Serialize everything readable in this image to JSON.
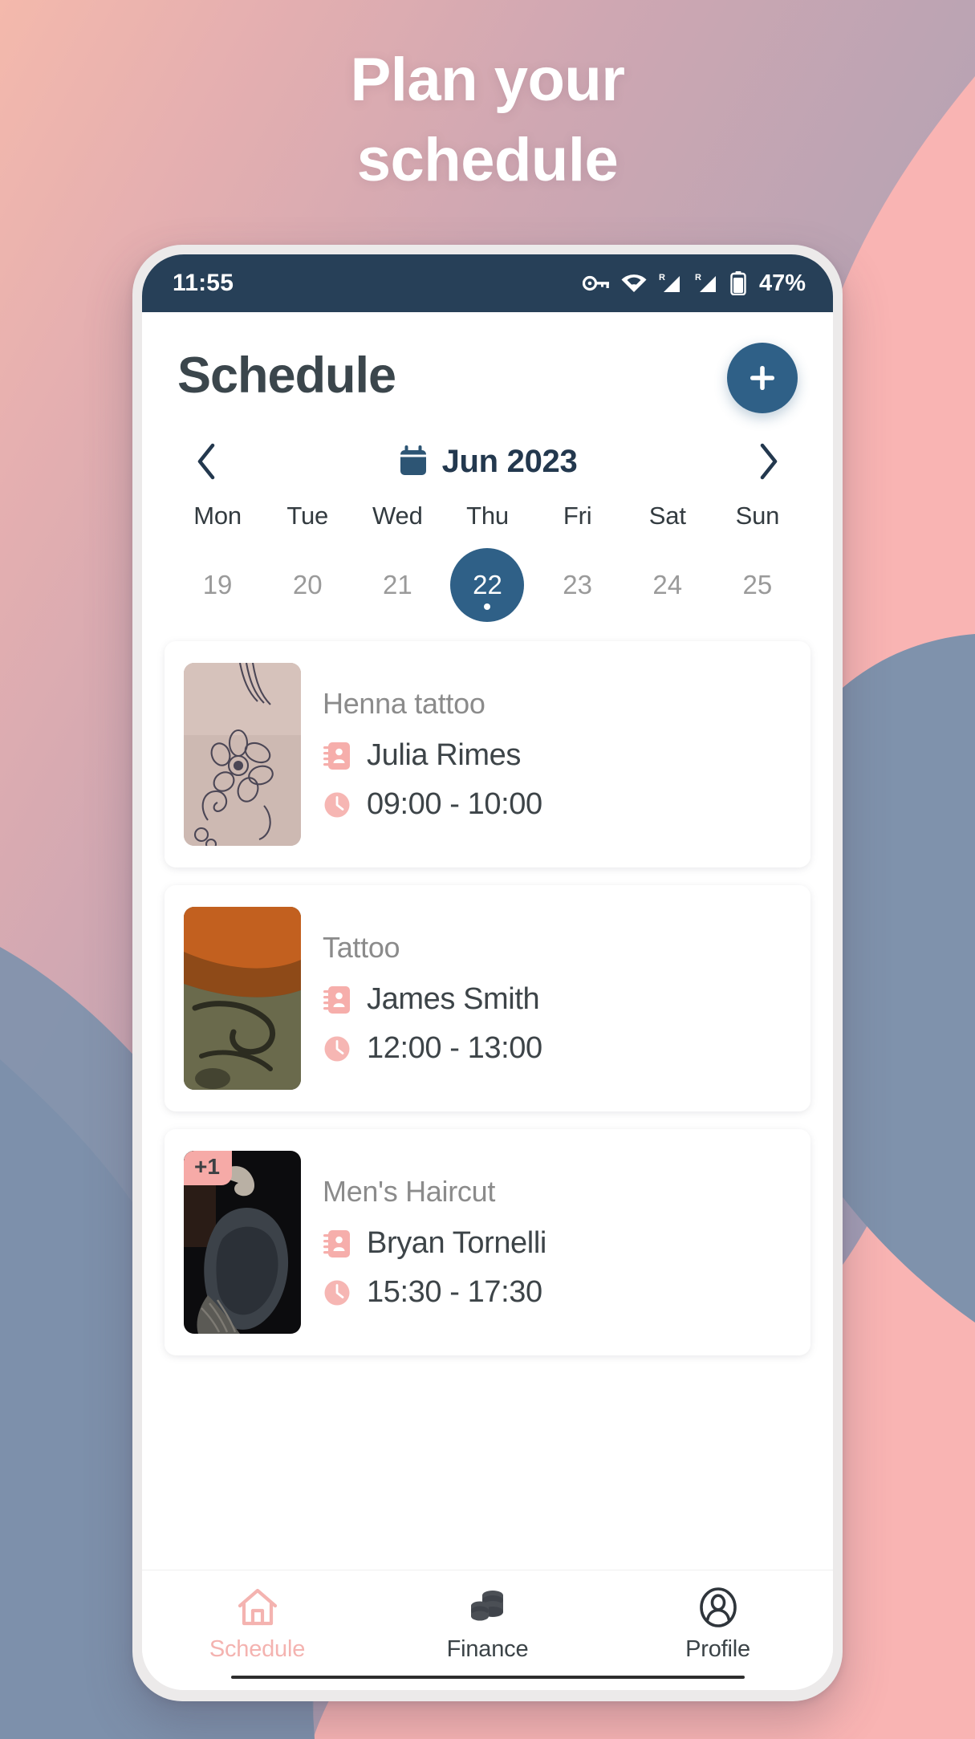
{
  "promo": {
    "headline_line1": "Plan your",
    "headline_line2": "schedule"
  },
  "colors": {
    "accent_blue": "#2f6087",
    "status_bar": "#274058",
    "accent_pink": "#f4b3b0",
    "badge_pink": "#f6aaa7",
    "title_gray": "#8b8b8b",
    "text_dark": "#3d4448"
  },
  "status_bar": {
    "time": "11:55",
    "battery_percent": "47%",
    "icons": [
      "vpn-key-icon",
      "wifi-icon",
      "signal-roaming-icon",
      "signal-roaming-icon",
      "battery-icon"
    ],
    "roaming_label": "R"
  },
  "header": {
    "title": "Schedule",
    "add_button_label": "+",
    "add_button_icon": "plus-icon"
  },
  "calendar": {
    "prev_icon": "chevron-left-icon",
    "next_icon": "chevron-right-icon",
    "calendar_icon": "calendar-icon",
    "month_label": "Jun 2023",
    "weekdays": [
      "Mon",
      "Tue",
      "Wed",
      "Thu",
      "Fri",
      "Sat",
      "Sun"
    ],
    "days": [
      {
        "num": "19",
        "selected": false
      },
      {
        "num": "20",
        "selected": false
      },
      {
        "num": "21",
        "selected": false
      },
      {
        "num": "22",
        "selected": true
      },
      {
        "num": "23",
        "selected": false
      },
      {
        "num": "24",
        "selected": false
      },
      {
        "num": "25",
        "selected": false
      }
    ]
  },
  "appointments": [
    {
      "title": "Henna tattoo",
      "client": "Julia Rimes",
      "time": "09:00 - 10:00",
      "client_icon": "contact-book-icon",
      "time_icon": "clock-icon",
      "badge": "",
      "thumb_name": "henna-tattoo-photo"
    },
    {
      "title": "Tattoo",
      "client": "James Smith",
      "time": "12:00 - 13:00",
      "client_icon": "contact-book-icon",
      "time_icon": "clock-icon",
      "badge": "",
      "thumb_name": "arm-tattoo-photo"
    },
    {
      "title": "Men's Haircut",
      "client": "Bryan Tornelli",
      "time": "15:30 - 17:30",
      "client_icon": "contact-book-icon",
      "time_icon": "clock-icon",
      "badge": "+1",
      "thumb_name": "haircut-photo"
    }
  ],
  "bottom_nav": [
    {
      "label": "Schedule",
      "icon": "home-icon",
      "active": true
    },
    {
      "label": "Finance",
      "icon": "coins-icon",
      "active": false
    },
    {
      "label": "Profile",
      "icon": "user-circle-icon",
      "active": false
    }
  ]
}
